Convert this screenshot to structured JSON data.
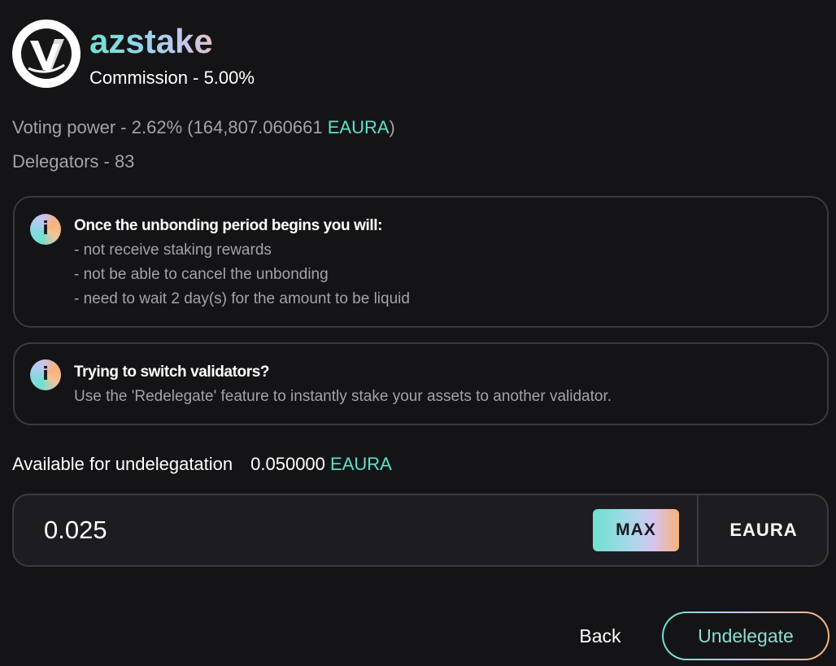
{
  "validator": {
    "name": "azstake",
    "commission": "Commission - 5.00%"
  },
  "stats": {
    "voting_power_label": "Voting power - 2.62%  (164,807.060661 ",
    "voting_power_denom": "EAURA",
    "voting_power_close": ")",
    "delegators": "Delegators - 83"
  },
  "unbonding_notice": {
    "icon": "info-icon",
    "title": "Once the unbonding period begins you will:",
    "lines": [
      "- not receive staking rewards",
      "- not be able to cancel the unbonding",
      "- need to wait 2 day(s) for the amount to be liquid"
    ]
  },
  "redelegate_notice": {
    "icon": "info-icon",
    "title": "Trying to switch validators?",
    "body": "Use the 'Redelegate' feature to instantly stake your assets to another validator."
  },
  "available": {
    "label": "Available for undelegatation",
    "amount": "0.050000",
    "denom": "EAURA"
  },
  "amount_input": {
    "value": "0.025",
    "max_label": "MAX",
    "denom": "EAURA"
  },
  "footer": {
    "back_label": "Back",
    "undelegate_label": "Undelegate"
  },
  "colors": {
    "background": "#141416",
    "accent": "#5fe0c8",
    "muted_text": "#a3a3a8",
    "border": "#3a3a40"
  }
}
